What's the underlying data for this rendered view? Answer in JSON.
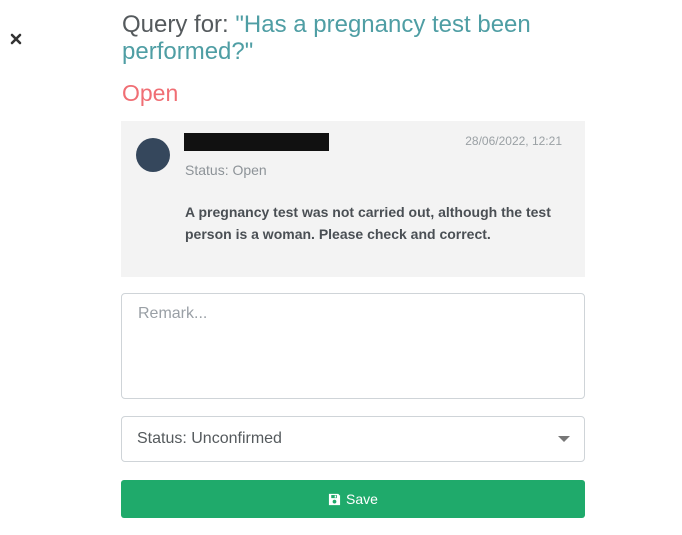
{
  "close": {
    "icon": "close-icon"
  },
  "header": {
    "prefix": "Query for: ",
    "question": "\"Has a pregnancy test been performed?\"",
    "status": "Open"
  },
  "comment": {
    "author": "",
    "timestamp": "28/06/2022, 12:21",
    "status": "Status: Open",
    "text": "A pregnancy test was not carried out, although the test person is a woman. Please check and correct."
  },
  "remark": {
    "placeholder": "Remark...",
    "value": ""
  },
  "status_select": {
    "selected": "Status: Unconfirmed"
  },
  "save": {
    "label": "Save",
    "icon": "save-icon"
  },
  "colors": {
    "question": "#4f9ea4",
    "open_status": "#f06e74",
    "save_button": "#1faa6b",
    "avatar": "#35475c"
  }
}
